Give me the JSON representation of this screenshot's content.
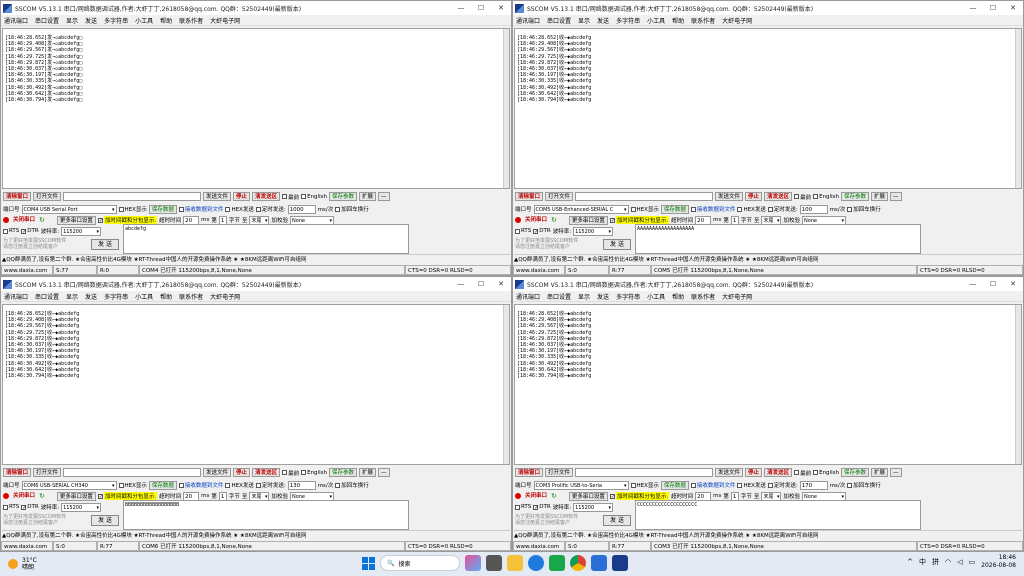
{
  "title": "SSCOM V5.13.1 串口/网络数据调试器,作者:大虾丁丁,2618058@qq.com. QQ群：52502449(最新版本)",
  "menu": [
    "通讯端口",
    "串口设置",
    "显示",
    "发送",
    "多字符串",
    "小工具",
    "帮助",
    "联系作者",
    "大虾电子网"
  ],
  "controls": {
    "minimize": "—",
    "maximize": "☐",
    "close": "✕"
  },
  "toolbar": {
    "clear": "清除窗口",
    "open_file": "打开文件",
    "send_file": "发送文件",
    "stop": "停止",
    "send_area": "清发送区",
    "top": "最前",
    "english": "English",
    "save_params": "保存参数",
    "expand": "扩展",
    "dash": "—"
  },
  "labels": {
    "port": "端口号",
    "hex_show": "HEX显示",
    "save_data": "保存数据",
    "recv_to_file": "接收数据到文件",
    "hex_send": "HEX发送",
    "timed_send": "定时发送:",
    "ms_per": "ms/次",
    "add_crlf": "加回车换行",
    "close_port": "关闭串口",
    "more_settings": "更多串口设置",
    "timestamp": "加时间戳和分包显示.",
    "timeout": "超时时间",
    "ms": "ms",
    "nth": "第",
    "byte": "字节",
    "to": "至",
    "end": "末尾",
    "checksum": "加校验",
    "none": "None",
    "rts": "RTS",
    "dtr": "DTR",
    "baud": "波特率:",
    "send": "发 送",
    "promo": "为了更好地发展SSCOM软件\n请您注册嘉立创结尾客户",
    "news": "▲QQ群满员了,没有第二个群. ★合宙高性价比4G模块 ★RT-Thread中国人的开源免费操作系统 ★ ★8KM远距离WiFi可自组网"
  },
  "windows": [
    {
      "port": "COM4 USB Serial Port",
      "interval": "1000",
      "timeout": "20",
      "nth": "1",
      "send_text": "abcdefg",
      "status": {
        "site": "www.daxia.com",
        "s": "S:77",
        "r": "R:0",
        "port_state": "COM4 已打开  115200bps,8,1,None,None",
        "lines": "CTS=0 DSR=0 RLSD=0"
      },
      "log": [
        "[18:46:28.652]发→◇abcdefg□",
        "[18:46:29.408]发→◇abcdefg□",
        "[18:46:29.567]发→◇abcdefg□",
        "[18:46:29.725]发→◇abcdefg□",
        "[18:46:29.872]发→◇abcdefg□",
        "[18:46:30.037]发→◇abcdefg□",
        "[18:46:30.197]发→◇abcdefg□",
        "[18:46:30.335]发→◇abcdefg□",
        "[18:46:30.492]发→◇abcdefg□",
        "[18:46:30.642]发→◇abcdefg□",
        "[18:46:30.794]发→◇abcdefg□"
      ]
    },
    {
      "port": "COM5 USB-Enhanced-SERIAL C",
      "interval": "100",
      "timeout": "20",
      "nth": "1",
      "send_text": "AAAAAAAAAAAAAAAAAAA",
      "status": {
        "site": "www.daxia.com",
        "s": "S:0",
        "r": "R:77",
        "port_state": "COM5 已打开  115200bps,8,1,None,None",
        "lines": "CTS=0 DSR=0 RLSD=0"
      },
      "log": [
        "[18:46:28.652]收←◆abcdefg",
        "[18:46:29.408]收←◆abcdefg",
        "[18:46:29.567]收←◆abcdefg",
        "[18:46:29.725]收←◆abcdefg",
        "[18:46:29.872]收←◆abcdefg",
        "[18:46:30.037]收←◆abcdefg",
        "[18:46:30.197]收←◆abcdefg",
        "[18:46:30.335]收←◆abcdefg",
        "[18:46:30.492]收←◆abcdefg",
        "[18:46:30.642]收←◆abcdefg",
        "[18:46:30.794]收←◆abcdefg"
      ]
    },
    {
      "port": "COM6 USB-SERIAL CH340",
      "interval": "130",
      "timeout": "20",
      "nth": "1",
      "send_text": "BBBBBBBBBBBBBBBBBB",
      "status": {
        "site": "www.daxia.com",
        "s": "S:0",
        "r": "R:77",
        "port_state": "COM6 已打开  115200bps,8,1,None,None",
        "lines": "CTS=0 DSR=0 RLSD=0"
      },
      "log": [
        "[18:46:28.652]收←◆abcdefg",
        "[18:46:29.408]收←◆abcdefg",
        "[18:46:29.567]收←◆abcdefg",
        "[18:46:29.725]收←◆abcdefg",
        "[18:46:29.872]收←◆abcdefg",
        "[18:46:30.037]收←◆abcdefg",
        "[18:46:30.197]收←◆abcdefg",
        "[18:46:30.335]收←◆abcdefg",
        "[18:46:30.492]收←◆abcdefg",
        "[18:46:30.642]收←◆abcdefg",
        "[18:46:30.794]收←◆abcdefg"
      ]
    },
    {
      "port": "COM3 Prolific USB-to-Seria",
      "interval": "170",
      "timeout": "20",
      "nth": "1",
      "send_text": "CCCCCCCCCCCCCCCCCCCC",
      "status": {
        "site": "www.daxia.com",
        "s": "S:0",
        "r": "R:77",
        "port_state": "COM3 已打开  115200bps,8,1,None,None",
        "lines": "CTS=0 DSR=0 RLSD=0"
      },
      "log": [
        "[18:46:28.652]收←◆abcdefg",
        "[18:46:29.408]收←◆abcdefg",
        "[18:46:29.567]收←◆abcdefg",
        "[18:46:29.725]收←◆abcdefg",
        "[18:46:29.872]收←◆abcdefg",
        "[18:46:30.037]收←◆abcdefg",
        "[18:46:30.197]收←◆abcdefg",
        "[18:46:30.335]收←◆abcdefg",
        "[18:46:30.492]收←◆abcdefg",
        "[18:46:30.642]收←◆abcdefg",
        "[18:46:30.794]收←◆abcdefg"
      ]
    }
  ],
  "taskbar": {
    "temp": "31°C",
    "weather": "晴朗",
    "search": "搜索",
    "ime1": "中",
    "ime2": "拼",
    "time": "18:46",
    "date": "2026-08-08",
    "tray_up": "^",
    "wifi_icon": "wifi-icon",
    "volume_icon": "volume-icon",
    "battery_icon": "battery-icon"
  },
  "baud": "115200"
}
